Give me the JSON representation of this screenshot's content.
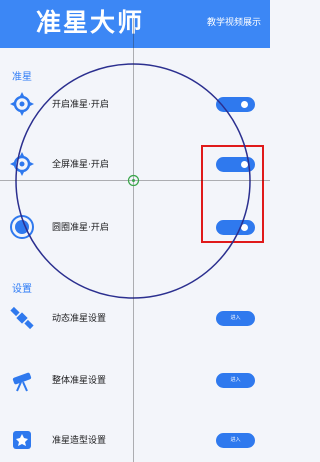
{
  "header": {
    "title": "准星大师",
    "tutorial_link": "教学视频展示"
  },
  "sections": {
    "crosshair": "准星",
    "settings": "设置"
  },
  "toggles": [
    {
      "label": "开启准星·开启",
      "on": true
    },
    {
      "label": "全屏准星·开启",
      "on": true
    },
    {
      "label": "圆圈准星·开启",
      "on": true
    }
  ],
  "settings": [
    {
      "label": "动态准星设置",
      "button": "进入"
    },
    {
      "label": "整体准星设置",
      "button": "进入"
    },
    {
      "label": "准星造型设置",
      "button": "进入"
    }
  ],
  "colors": {
    "header": "#3c87f5",
    "accent": "#2f79ee",
    "highlight": "#e01a1a",
    "circle": "#2b2f8f"
  }
}
